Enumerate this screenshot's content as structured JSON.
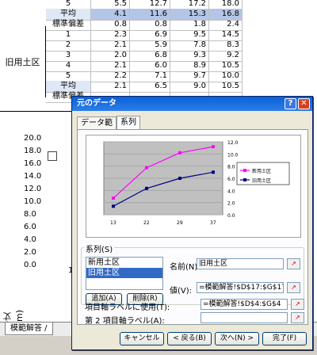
{
  "sheet": {
    "rows": [
      {
        "label": "",
        "cols": [
          "5",
          "5.5",
          "12.7",
          "17.2",
          "18.0"
        ]
      },
      {
        "label": "",
        "cols": [
          "平均",
          "4.1",
          "11.6",
          "15.3",
          "16.8"
        ]
      },
      {
        "label": "",
        "cols": [
          "標準偏差",
          "0.8",
          "0.8",
          "1.8",
          "2.4"
        ]
      },
      {
        "label": "",
        "cols": [
          "1",
          "2.3",
          "6.9",
          "9.5",
          "14.5"
        ]
      },
      {
        "label": "",
        "cols": [
          "2",
          "2.1",
          "5.9",
          "7.8",
          "8.3"
        ]
      },
      {
        "label": "",
        "cols": [
          "3",
          "2.0",
          "6.8",
          "9.3",
          "9.2"
        ]
      },
      {
        "label": "",
        "cols": [
          "4",
          "2.1",
          "6.0",
          "8.9",
          "10.5"
        ]
      },
      {
        "label": "",
        "cols": [
          "5",
          "2.2",
          "7.1",
          "9.7",
          "10.0"
        ]
      },
      {
        "label": "",
        "cols": [
          "平均",
          "2.1",
          "6.5",
          "9.0",
          "10.5"
        ]
      },
      {
        "label": "",
        "cols": [
          "標準偏差",
          "",
          "",
          "",
          ""
        ]
      }
    ],
    "group_label": "旧用土区",
    "chart_yticks": [
      "20.0",
      "18.0",
      "16.0",
      "14.0",
      "12.0",
      "10.0",
      "8.0",
      "6.0",
      "4.0",
      "2.0",
      "0.0"
    ],
    "chart_ylabel": "草丈(cm)",
    "chart_partial_label": "1",
    "sheet_tab": "模範解答"
  },
  "dialog": {
    "title": "元のデータ",
    "tab_range": "データ範囲",
    "tab_series": "系列",
    "series_group_label": "系列(S)",
    "series_items": [
      "新用土区",
      "旧用土区"
    ],
    "selected_series": 1,
    "name_label": "名前(N):",
    "name_value": "旧用土区",
    "values_label": "値(V):",
    "values_value": "=模範解答!$D$17:$G$17",
    "add_button": "追加(A)",
    "remove_button": "削除(R)",
    "category_label": "項目軸ラベルに使用(T):",
    "category_value": "=模範解答!$D$4:$G$4",
    "secondary_category_label": "第 2 項目軸ラベル(A):",
    "secondary_category_value": "",
    "cancel_button": "キャンセル",
    "back_button": "< 戻る(B)",
    "next_button": "次へ(N) >",
    "finish_button": "完了(F)",
    "help_button": "?",
    "close_button": "✕"
  },
  "chart_data": {
    "type": "line",
    "categories": [
      "13",
      "22",
      "29",
      "37"
    ],
    "ylim": [
      0,
      12
    ],
    "yticks": [
      "12.0",
      "10.0",
      "8.0",
      "6.0",
      "4.0",
      "2.0",
      "0.0"
    ],
    "series": [
      {
        "name": "新用土区",
        "color": "#ff00ff",
        "values": [
          4.1,
          11.6,
          15.3,
          16.8
        ]
      },
      {
        "name": "旧用土区",
        "color": "#000080",
        "values": [
          2.1,
          6.5,
          9.0,
          10.5
        ]
      }
    ],
    "legend": "right"
  }
}
